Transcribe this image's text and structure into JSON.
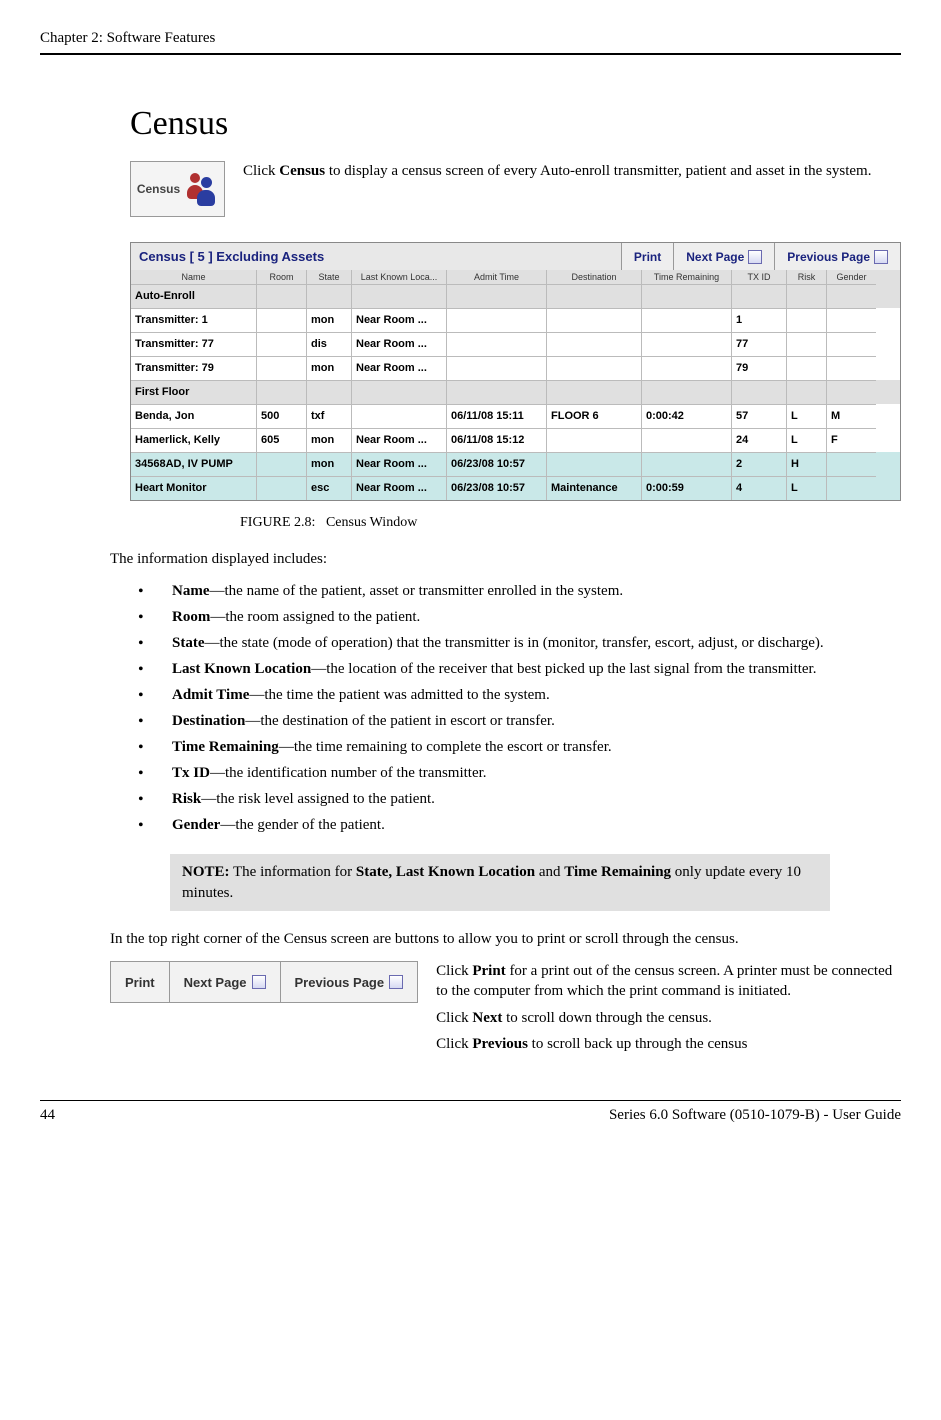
{
  "page": {
    "chapter_header": "Chapter 2: Software Features",
    "section_title": "Census",
    "census_icon_label": "Census",
    "intro_pre": "Click ",
    "intro_bold": "Census",
    "intro_post": " to display a census screen of every Auto-enroll transmitter, patient and asset in the system.",
    "figure_caption_label": "FIGURE 2.8:",
    "figure_caption_text": "Census Window",
    "info_intro": "The information displayed includes:",
    "bullets": [
      {
        "bold": "Name",
        "rest": "—the name of the patient, asset or transmitter enrolled in the system."
      },
      {
        "bold": "Room",
        "rest": "—the room assigned to the patient."
      },
      {
        "bold": "State",
        "rest": "—the state (mode of operation) that the transmitter is in (monitor, transfer, escort, adjust, or discharge)."
      },
      {
        "bold": "Last Known Location",
        "rest": "—the location of the receiver that best picked up the last signal from the transmitter."
      },
      {
        "bold": "Admit Time",
        "rest": "—the time the patient was admitted to the system."
      },
      {
        "bold": "Destination",
        "rest": "—the destination of the patient in escort or transfer."
      },
      {
        "bold": "Time Remaining",
        "rest": "—the time remaining to complete the escort or transfer."
      },
      {
        "bold": "Tx ID",
        "rest": "—the identification number of the transmitter."
      },
      {
        "bold": "Risk",
        "rest": "—the risk level assigned to the patient."
      },
      {
        "bold": "Gender",
        "rest": "—the gender of the patient."
      }
    ],
    "note_label": "NOTE:",
    "note_text_pre": " The information for ",
    "note_bold": "State, Last Known Location",
    "note_and": " and ",
    "note_bold2": "Time Remaining",
    "note_post": " only update every 10 minutes.",
    "below_note": "In the top right corner of the Census screen are buttons to allow you to print or scroll through the census.",
    "print_pre": "Click ",
    "print_bold": "Print",
    "print_post": " for a print out of the census screen. A printer must be connected to the computer from which the print command is initiated.",
    "next_pre": "Click ",
    "next_bold": "Next",
    "next_post": " to scroll down through the census.",
    "prev_pre": "Click ",
    "prev_bold": "Previous",
    "prev_post": " to scroll back up through the census",
    "footer_page": "44",
    "footer_right": "Series 6.0 Software (0510-1079-B) - User Guide"
  },
  "census_window": {
    "title": "Census [ 5 ] Excluding Assets",
    "btn_print": "Print",
    "btn_next": "Next Page",
    "btn_prev": "Previous Page",
    "headers": {
      "name": "Name",
      "room": "Room",
      "state": "State",
      "loc": "Last Known Loca...",
      "admit": "Admit Time",
      "dest": "Destination",
      "time": "Time Remaining",
      "txid": "TX ID",
      "risk": "Risk",
      "gender": "Gender"
    },
    "section_auto": "Auto-Enroll",
    "section_first": "First Floor",
    "r1": {
      "name": "Transmitter: 1",
      "room": "",
      "state": "mon",
      "loc": "Near Room ...",
      "admit": "",
      "dest": "",
      "time": "",
      "txid": "1",
      "risk": "",
      "gender": ""
    },
    "r2": {
      "name": "Transmitter: 77",
      "room": "",
      "state": "dis",
      "loc": "Near Room ...",
      "admit": "",
      "dest": "",
      "time": "",
      "txid": "77",
      "risk": "",
      "gender": ""
    },
    "r3": {
      "name": "Transmitter: 79",
      "room": "",
      "state": "mon",
      "loc": "Near Room ...",
      "admit": "",
      "dest": "",
      "time": "",
      "txid": "79",
      "risk": "",
      "gender": ""
    },
    "r4": {
      "name": "Benda, Jon",
      "room": "500",
      "state": "txf",
      "loc": "",
      "admit": "06/11/08 15:11",
      "dest": "FLOOR 6",
      "time": "0:00:42",
      "txid": "57",
      "risk": "L",
      "gender": "M"
    },
    "r5": {
      "name": "Hamerlick, Kelly",
      "room": "605",
      "state": "mon",
      "loc": "Near Room ...",
      "admit": "06/11/08 15:12",
      "dest": "",
      "time": "",
      "txid": "24",
      "risk": "L",
      "gender": "F"
    },
    "r6": {
      "name": "34568AD, IV PUMP",
      "room": "",
      "state": "mon",
      "loc": "Near Room ...",
      "admit": "06/23/08 10:57",
      "dest": "",
      "time": "",
      "txid": "2",
      "risk": "H",
      "gender": ""
    },
    "r7": {
      "name": "Heart Monitor",
      "room": "",
      "state": "esc",
      "loc": "Near Room ...",
      "admit": "06/23/08 10:57",
      "dest": "Maintenance",
      "time": "0:00:59",
      "txid": "4",
      "risk": "L",
      "gender": ""
    }
  },
  "button_strip": {
    "print": "Print",
    "next": "Next Page",
    "prev": "Previous Page"
  }
}
